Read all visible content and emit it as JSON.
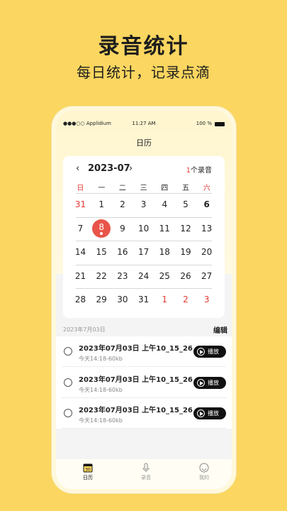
{
  "promo": {
    "title": "录音统计",
    "subtitle": "每日统计，记录点滴"
  },
  "status_bar": {
    "carrier": "●●●○○ Applidium",
    "time": "11:27 AM",
    "battery": "100 %"
  },
  "nav": {
    "title": "日历"
  },
  "calendar": {
    "prev": "‹",
    "next": "›",
    "month": "2023-07",
    "count_num": "1",
    "count_text": "个录音",
    "weekdays": [
      "日",
      "一",
      "二",
      "三",
      "四",
      "五",
      "六"
    ],
    "weeks": [
      [
        "31",
        "1",
        "2",
        "3",
        "4",
        "5",
        "6"
      ],
      [
        "7",
        "8",
        "9",
        "10",
        "11",
        "12",
        "13"
      ],
      [
        "14",
        "15",
        "16",
        "17",
        "18",
        "19",
        "20"
      ],
      [
        "21",
        "22",
        "23",
        "24",
        "25",
        "26",
        "27"
      ],
      [
        "28",
        "29",
        "30",
        "31",
        "1",
        "2",
        "3"
      ]
    ],
    "selected_day": "8"
  },
  "list_header": {
    "date": "2023年7月03日",
    "edit": "编辑"
  },
  "recordings": [
    {
      "title": "2023年07月03日 上午10_15_26",
      "meta": "今天14:18-60kb",
      "play": "播放"
    },
    {
      "title": "2023年07月03日 上午10_15_26",
      "meta": "今天14:18-60kb",
      "play": "播放"
    },
    {
      "title": "2023年07月03日 上午10_15_26",
      "meta": "今天14:18-60kb",
      "play": "播放"
    }
  ],
  "tabs": [
    {
      "label": "日历",
      "icon": "calendar-icon",
      "active": true
    },
    {
      "label": "录音",
      "icon": "microphone-icon",
      "active": false
    },
    {
      "label": "我的",
      "icon": "smile-face-icon",
      "active": false
    }
  ],
  "colors": {
    "background": "#fbd660",
    "accent_red": "#e53935",
    "today_circle": "#e8544a",
    "play_button": "#111111"
  }
}
